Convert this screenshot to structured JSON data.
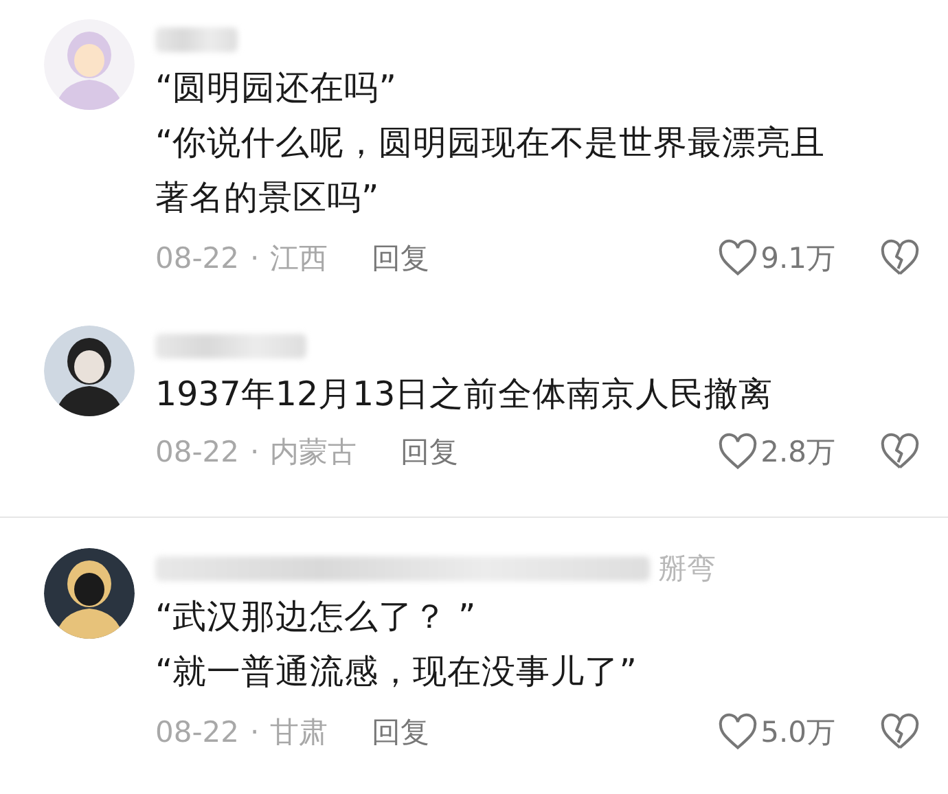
{
  "comments": [
    {
      "lines": [
        "“圆明园还在吗”",
        "“你说什么呢，圆明园现在不是世界最漂亮且著名的景区吗”"
      ],
      "date": "08-22",
      "separator": "·",
      "region": "江西",
      "reply": "回复",
      "likes": "9.1万"
    },
    {
      "lines": [
        "1937年12月13日之前全体南京人民撤离"
      ],
      "date": "08-22",
      "separator": "·",
      "region": "内蒙古",
      "reply": "回复",
      "likes": "2.8万"
    },
    {
      "name_visible": "掰弯",
      "lines": [
        "“武汉那边怎么了？ ”",
        "“就一普通流感，现在没事儿了”"
      ],
      "date": "08-22",
      "separator": "·",
      "region": "甘肃",
      "reply": "回复",
      "likes": "5.0万"
    }
  ]
}
